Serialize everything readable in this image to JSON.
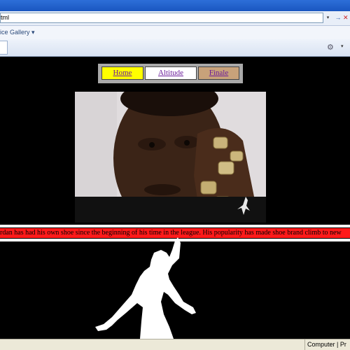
{
  "browser": {
    "address": "tml",
    "favorites_label": "ice Gallery",
    "favorites_arrow": "▾",
    "go_glyph": "→",
    "stop_glyph": "✕",
    "dropdown_glyph": "▾",
    "tools_glyph": "⚙",
    "status_zone": "Computer | Pr"
  },
  "nav": {
    "items": [
      {
        "label": "Home"
      },
      {
        "label": "Altitude"
      },
      {
        "label": "Finale"
      }
    ],
    "colors": {
      "home": "#ffff00",
      "altitude": "#ffffff",
      "finale": "#c8a27a"
    }
  },
  "ticker": {
    "text": "rdan has had his own shoe since the beginning of his time in the league. His popularity has made shoe brand climb to new"
  }
}
